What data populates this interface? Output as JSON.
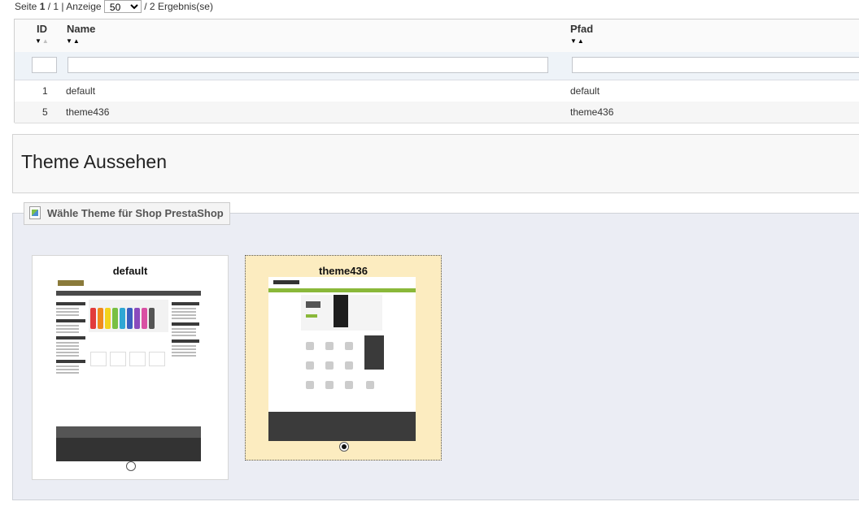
{
  "pager": {
    "page_label": "Seite",
    "current_page": "1",
    "page_sep": "/ 1 | Anzeige",
    "per_page": "50",
    "results": "/ 2 Ergebnis(se)"
  },
  "table": {
    "columns": {
      "id": "ID",
      "name": "Name",
      "path": "Pfad"
    },
    "rows": [
      {
        "id": "1",
        "name": "default",
        "path": "default"
      },
      {
        "id": "5",
        "name": "theme436",
        "path": "theme436"
      }
    ]
  },
  "panel": {
    "title": "Theme Aussehen"
  },
  "fieldset": {
    "legend": "Wähle Theme für Shop PrestaShop",
    "themes": [
      {
        "name": "default",
        "selected": false
      },
      {
        "name": "theme436",
        "selected": true
      }
    ]
  },
  "colors": {
    "selected_bg": "#fcecc0",
    "fieldset_bg": "#ebedf4",
    "filter_row_bg": "#eef3f8"
  }
}
